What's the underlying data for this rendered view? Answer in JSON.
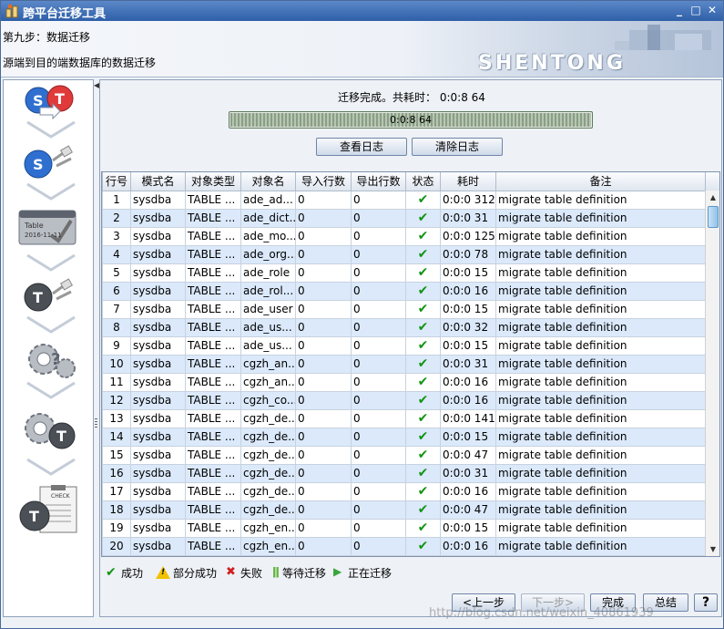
{
  "window": {
    "title": "跨平台迁移工具",
    "min": "_",
    "max": "□",
    "close": "✕"
  },
  "header": {
    "step": "第九步：数据迁移",
    "description": "源端到目的端数据库的数据迁移",
    "logo": "SHENTONG"
  },
  "main": {
    "status": "迁移完成。共耗时： 0:0:8 64",
    "progress": {
      "label": "0:0:8 64",
      "fraction": 1.0
    },
    "view_log": "查看日志",
    "clear_log": "清除日志"
  },
  "table": {
    "columns": [
      "行号",
      "模式名",
      "对象类型",
      "对象名",
      "导入行数",
      "导出行数",
      "状态",
      "耗时",
      "备注"
    ],
    "rows": [
      [
        "1",
        "sysdba",
        "TABLE ...",
        "ade_ad...",
        "0",
        "0",
        "✔",
        "0:0:0 312",
        "migrate table definition"
      ],
      [
        "2",
        "sysdba",
        "TABLE ...",
        "ade_dict...",
        "0",
        "0",
        "✔",
        "0:0:0 31",
        "migrate table definition"
      ],
      [
        "3",
        "sysdba",
        "TABLE ...",
        "ade_mo...",
        "0",
        "0",
        "✔",
        "0:0:0 125",
        "migrate table definition"
      ],
      [
        "4",
        "sysdba",
        "TABLE ...",
        "ade_org...",
        "0",
        "0",
        "✔",
        "0:0:0 78",
        "migrate table definition"
      ],
      [
        "5",
        "sysdba",
        "TABLE ...",
        "ade_role",
        "0",
        "0",
        "✔",
        "0:0:0 15",
        "migrate table definition"
      ],
      [
        "6",
        "sysdba",
        "TABLE ...",
        "ade_rol...",
        "0",
        "0",
        "✔",
        "0:0:0 16",
        "migrate table definition"
      ],
      [
        "7",
        "sysdba",
        "TABLE ...",
        "ade_user",
        "0",
        "0",
        "✔",
        "0:0:0 15",
        "migrate table definition"
      ],
      [
        "8",
        "sysdba",
        "TABLE ...",
        "ade_us...",
        "0",
        "0",
        "✔",
        "0:0:0 32",
        "migrate table definition"
      ],
      [
        "9",
        "sysdba",
        "TABLE ...",
        "ade_us...",
        "0",
        "0",
        "✔",
        "0:0:0 15",
        "migrate table definition"
      ],
      [
        "10",
        "sysdba",
        "TABLE ...",
        "cgzh_an...",
        "0",
        "0",
        "✔",
        "0:0:0 31",
        "migrate table definition"
      ],
      [
        "11",
        "sysdba",
        "TABLE ...",
        "cgzh_an...",
        "0",
        "0",
        "✔",
        "0:0:0 16",
        "migrate table definition"
      ],
      [
        "12",
        "sysdba",
        "TABLE ...",
        "cgzh_co...",
        "0",
        "0",
        "✔",
        "0:0:0 16",
        "migrate table definition"
      ],
      [
        "13",
        "sysdba",
        "TABLE ...",
        "cgzh_de...",
        "0",
        "0",
        "✔",
        "0:0:0 141",
        "migrate table definition"
      ],
      [
        "14",
        "sysdba",
        "TABLE ...",
        "cgzh_de...",
        "0",
        "0",
        "✔",
        "0:0:0 15",
        "migrate table definition"
      ],
      [
        "15",
        "sysdba",
        "TABLE ...",
        "cgzh_de...",
        "0",
        "0",
        "✔",
        "0:0:0 47",
        "migrate table definition"
      ],
      [
        "16",
        "sysdba",
        "TABLE ...",
        "cgzh_de...",
        "0",
        "0",
        "✔",
        "0:0:0 31",
        "migrate table definition"
      ],
      [
        "17",
        "sysdba",
        "TABLE ...",
        "cgzh_de...",
        "0",
        "0",
        "✔",
        "0:0:0 16",
        "migrate table definition"
      ],
      [
        "18",
        "sysdba",
        "TABLE ...",
        "cgzh_de...",
        "0",
        "0",
        "✔",
        "0:0:0 47",
        "migrate table definition"
      ],
      [
        "19",
        "sysdba",
        "TABLE ...",
        "cgzh_en...",
        "0",
        "0",
        "✔",
        "0:0:0 15",
        "migrate table definition"
      ],
      [
        "20",
        "sysdba",
        "TABLE ...",
        "cgzh_en...",
        "0",
        "0",
        "✔",
        "0:0:0 16",
        "migrate table definition"
      ]
    ]
  },
  "legend": {
    "success": "成功",
    "partial": "部分成功",
    "fail": "失败",
    "waiting": "等待迁移",
    "running": "正在迁移"
  },
  "footer": {
    "prev": "<上一步",
    "next": "下一步>",
    "finish": "完成",
    "summary": "总结",
    "help": "?",
    "watermark": "http://blog.csdn.net/weixin_40861939"
  },
  "step_icons": {
    "table_label": "Table",
    "table_date": "2016-11-11",
    "checklist_label": "CHECK"
  },
  "colors": {
    "success": "#119411",
    "fail": "#d02020",
    "warning": "#f2c200",
    "row_alt": "#dbe9fb"
  }
}
